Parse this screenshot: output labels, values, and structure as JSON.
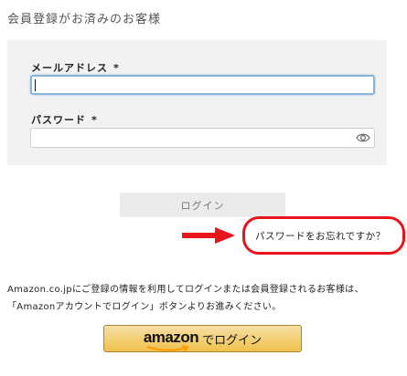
{
  "section_title": "会員登録がお済みのお客様",
  "form": {
    "email": {
      "label": "メールアドレス",
      "required_mark": "*",
      "value": "",
      "placeholder": ""
    },
    "password": {
      "label": "パスワード",
      "required_mark": "*",
      "value": "",
      "placeholder": ""
    }
  },
  "login_button": "ログイン",
  "forgot_password_link": "パスワードをお忘れですか？",
  "annotation": {
    "color": "#e8141b"
  },
  "amazon_info": "Amazon.co.jpにご登録の情報を利用してログインまたは会員登録されるお客様は、「Amazonアカウントでログイン」ボタンよりお進みください。",
  "amazon_button": {
    "logo": "amazon",
    "label": "でログイン"
  },
  "colors": {
    "panel_bg": "#f2f2f2",
    "login_button_bg": "#ebebeb",
    "amazon_button_top": "#f7dfa5",
    "amazon_button_bottom": "#f0c14b",
    "amazon_smile": "#f90"
  }
}
